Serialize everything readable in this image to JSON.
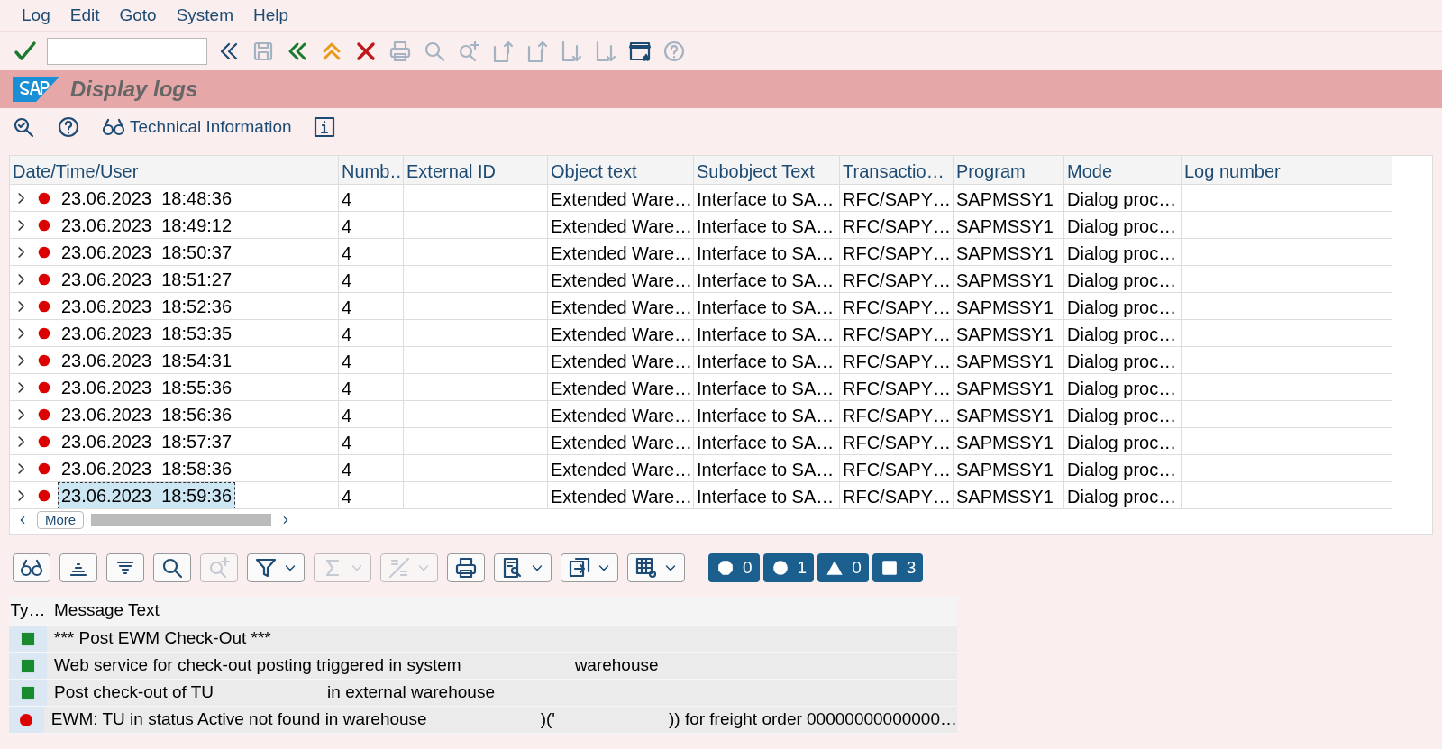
{
  "menu": [
    "Log",
    "Edit",
    "Goto",
    "System",
    "Help"
  ],
  "toolbar": [
    {
      "kind": "check"
    },
    {
      "kind": "field"
    },
    {
      "kind": "back",
      "disabled": false
    },
    {
      "kind": "save",
      "disabled": true
    },
    {
      "kind": "exit"
    },
    {
      "kind": "up"
    },
    {
      "kind": "cancel"
    },
    {
      "kind": "print",
      "disabled": true
    },
    {
      "kind": "find",
      "disabled": true
    },
    {
      "kind": "findnext",
      "disabled": true
    },
    {
      "kind": "first",
      "disabled": true
    },
    {
      "kind": "prev",
      "disabled": true
    },
    {
      "kind": "next",
      "disabled": true
    },
    {
      "kind": "last",
      "disabled": true
    },
    {
      "kind": "window",
      "disabled": false
    },
    {
      "kind": "help",
      "disabled": true
    }
  ],
  "title": "Display logs",
  "app_toolbar": [
    {
      "kind": "detail"
    },
    {
      "kind": "help"
    },
    {
      "kind": "glasses",
      "label": "Technical Information"
    },
    {
      "kind": "info"
    }
  ],
  "table": {
    "columns": [
      "Date/Time/User",
      "Numb…",
      "External ID",
      "Object text",
      "Subobject Text",
      "Transactio…",
      "Program",
      "Mode",
      "Log number"
    ],
    "rows": [
      {
        "date": "23.06.2023",
        "time": "18:48:36",
        "number": "4",
        "object": "Extended Ware…",
        "subobject": "Interface to SA…",
        "transaction": "RFC/SAPY…",
        "program": "SAPMSSY1",
        "mode": "Dialog proc…",
        "selected": false
      },
      {
        "date": "23.06.2023",
        "time": "18:49:12",
        "number": "4",
        "object": "Extended Ware…",
        "subobject": "Interface to SA…",
        "transaction": "RFC/SAPY…",
        "program": "SAPMSSY1",
        "mode": "Dialog proc…",
        "selected": false
      },
      {
        "date": "23.06.2023",
        "time": "18:50:37",
        "number": "4",
        "object": "Extended Ware…",
        "subobject": "Interface to SA…",
        "transaction": "RFC/SAPY…",
        "program": "SAPMSSY1",
        "mode": "Dialog proc…",
        "selected": false
      },
      {
        "date": "23.06.2023",
        "time": "18:51:27",
        "number": "4",
        "object": "Extended Ware…",
        "subobject": "Interface to SA…",
        "transaction": "RFC/SAPY…",
        "program": "SAPMSSY1",
        "mode": "Dialog proc…",
        "selected": false
      },
      {
        "date": "23.06.2023",
        "time": "18:52:36",
        "number": "4",
        "object": "Extended Ware…",
        "subobject": "Interface to SA…",
        "transaction": "RFC/SAPY…",
        "program": "SAPMSSY1",
        "mode": "Dialog proc…",
        "selected": false
      },
      {
        "date": "23.06.2023",
        "time": "18:53:35",
        "number": "4",
        "object": "Extended Ware…",
        "subobject": "Interface to SA…",
        "transaction": "RFC/SAPY…",
        "program": "SAPMSSY1",
        "mode": "Dialog proc…",
        "selected": false
      },
      {
        "date": "23.06.2023",
        "time": "18:54:31",
        "number": "4",
        "object": "Extended Ware…",
        "subobject": "Interface to SA…",
        "transaction": "RFC/SAPY…",
        "program": "SAPMSSY1",
        "mode": "Dialog proc…",
        "selected": false
      },
      {
        "date": "23.06.2023",
        "time": "18:55:36",
        "number": "4",
        "object": "Extended Ware…",
        "subobject": "Interface to SA…",
        "transaction": "RFC/SAPY…",
        "program": "SAPMSSY1",
        "mode": "Dialog proc…",
        "selected": false
      },
      {
        "date": "23.06.2023",
        "time": "18:56:36",
        "number": "4",
        "object": "Extended Ware…",
        "subobject": "Interface to SA…",
        "transaction": "RFC/SAPY…",
        "program": "SAPMSSY1",
        "mode": "Dialog proc…",
        "selected": false
      },
      {
        "date": "23.06.2023",
        "time": "18:57:37",
        "number": "4",
        "object": "Extended Ware…",
        "subobject": "Interface to SA…",
        "transaction": "RFC/SAPY…",
        "program": "SAPMSSY1",
        "mode": "Dialog proc…",
        "selected": false
      },
      {
        "date": "23.06.2023",
        "time": "18:58:36",
        "number": "4",
        "object": "Extended Ware…",
        "subobject": "Interface to SA…",
        "transaction": "RFC/SAPY…",
        "program": "SAPMSSY1",
        "mode": "Dialog proc…",
        "selected": false
      },
      {
        "date": "23.06.2023",
        "time": "18:59:36",
        "number": "4",
        "object": "Extended Ware…",
        "subobject": "Interface to SA…",
        "transaction": "RFC/SAPY…",
        "program": "SAPMSSY1",
        "mode": "Dialog proc…",
        "selected": true
      }
    ],
    "more_button": "More"
  },
  "alv_toolbar": [
    {
      "kind": "glasses"
    },
    {
      "kind": "sortup"
    },
    {
      "kind": "sortdown"
    },
    {
      "kind": "find"
    },
    {
      "kind": "findnext",
      "disabled": true
    },
    {
      "kind": "filter",
      "menu": true
    },
    {
      "kind": "sum",
      "menu": true,
      "disabled": true
    },
    {
      "kind": "subtotal",
      "menu": true,
      "disabled": true
    },
    {
      "kind": "print"
    },
    {
      "kind": "view",
      "menu": true
    },
    {
      "kind": "export",
      "menu": true
    },
    {
      "kind": "layout",
      "menu": true
    }
  ],
  "counters": [
    {
      "kind": "octagon",
      "count": "0"
    },
    {
      "kind": "circle",
      "count": "1"
    },
    {
      "kind": "triangle",
      "count": "0"
    },
    {
      "kind": "square",
      "count": "3"
    }
  ],
  "messages": {
    "columns": [
      "Ty…",
      "Message Text"
    ],
    "rows": [
      {
        "kind": "success",
        "parts": [
          {
            "kind": "text",
            "text": "*** Post EWM Check-Out ***"
          }
        ]
      },
      {
        "kind": "success",
        "parts": [
          {
            "kind": "text",
            "text": "Web service for check-out posting triggered in system"
          },
          {
            "kind": "redacted"
          },
          {
            "kind": "text",
            "text": "warehouse"
          }
        ]
      },
      {
        "kind": "success",
        "parts": [
          {
            "kind": "text",
            "text": "Post check-out of TU"
          },
          {
            "kind": "redacted"
          },
          {
            "kind": "text",
            "text": "in external warehouse"
          }
        ]
      },
      {
        "kind": "error",
        "parts": [
          {
            "kind": "text",
            "text": "EWM: TU in status Active not found in warehouse"
          },
          {
            "kind": "redacted"
          },
          {
            "kind": "text",
            "text": ")('"
          },
          {
            "kind": "redacted"
          },
          {
            "kind": "text",
            "text": ")) for freight order 00000000000000…"
          }
        ]
      }
    ]
  }
}
